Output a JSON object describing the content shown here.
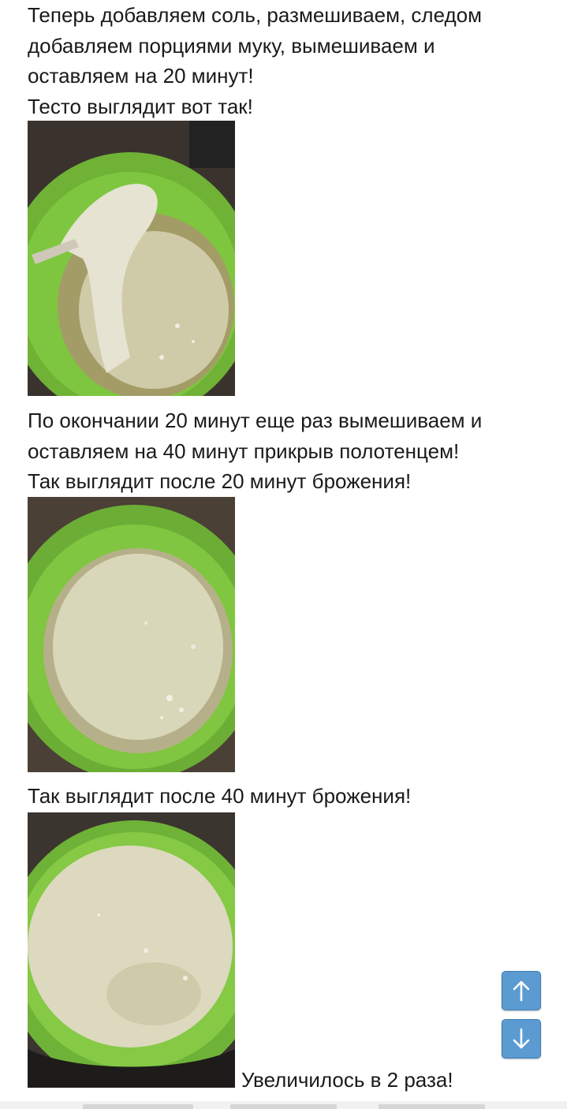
{
  "article": {
    "paragraph_1": [
      "Теперь добавляем соль, размешиваем, следом",
      "добавляем порциями муку, вымешиваем и",
      "оставляем на 20 минут!",
      "Тесто выглядит вот так!"
    ],
    "paragraph_2": [
      "По окончании 20 минут еще раз вымешиваем и",
      "оставляем на 40 минут прикрыв полотенцем!",
      "Так выглядит после 20 минут брожения!"
    ],
    "paragraph_3": [
      "Так выглядит после 40 минут брожения!"
    ],
    "caption_final": "Увеличилось в 2 раза!"
  },
  "photos": {
    "photo_1": "dough-in-green-bowl-initial",
    "photo_2": "dough-after-20-minutes",
    "photo_3": "dough-after-40-minutes"
  },
  "controls": {
    "scroll_up_icon": "arrow-up-icon",
    "scroll_down_icon": "arrow-down-icon"
  },
  "colors": {
    "scroll_button": "#5b9bd1",
    "bowl_green": "#7cc23a",
    "dough": "#d8d6b8"
  }
}
